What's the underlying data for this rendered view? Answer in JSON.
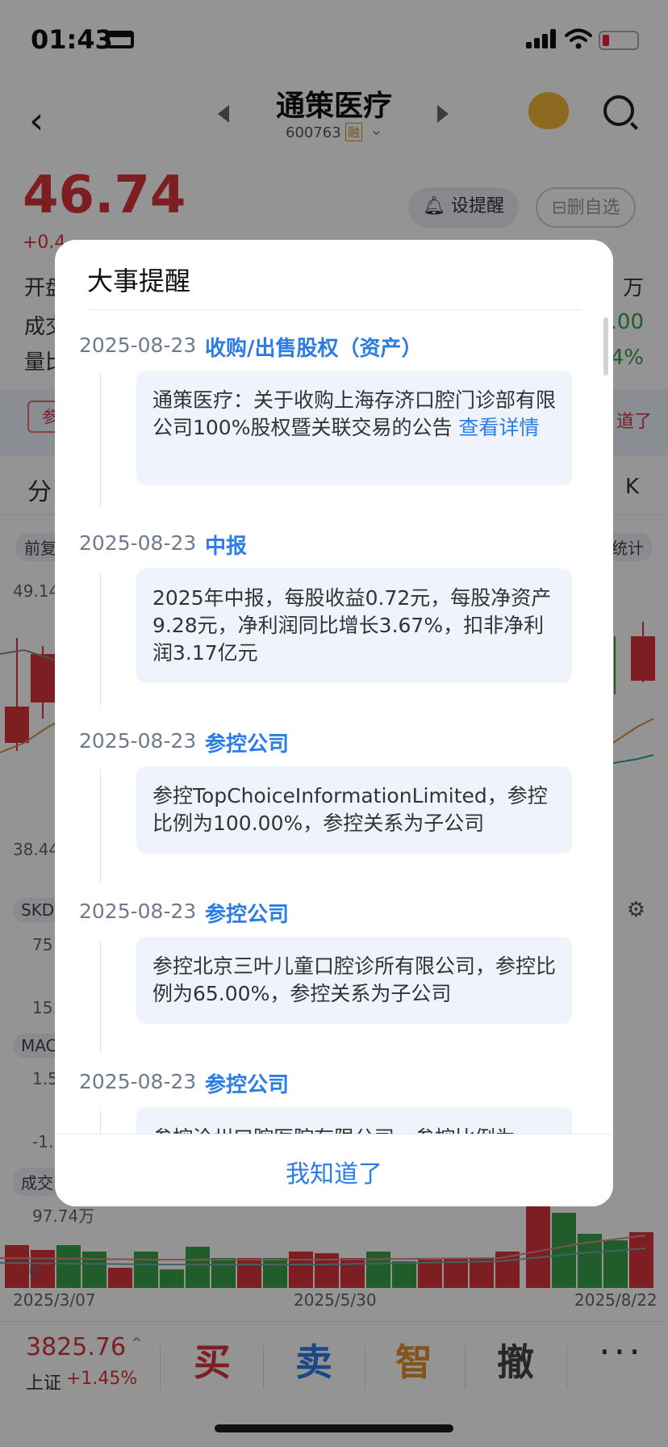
{
  "status_bar": {
    "time": "01:43"
  },
  "header": {
    "stock_name": "通策医疗",
    "stock_code": "600763",
    "margin_tag": "融"
  },
  "quote": {
    "price": "46.74",
    "change_partial": "+0.4",
    "alert_button": "设提醒",
    "remove_watch_button": "删自选",
    "row1_left": "开盘",
    "row1_right": "万",
    "row2_left": "成交",
    "row2_right": ".00",
    "row3_left": "量比",
    "row3_right": "4%"
  },
  "band": {
    "tag_label": "参",
    "know_text": "道了"
  },
  "chart_tabs": {
    "left": "分",
    "right": "K"
  },
  "chart_area": {
    "restore_pill": "前复",
    "stats_pill": "统计",
    "y_top": "49.14",
    "y_bottom": "38.44",
    "skd_label": "SKD",
    "skd_val_top": "75",
    "skd_val_bottom": "15.",
    "macd_label": "MAC",
    "macd_val_top": "1.5",
    "macd_val_bottom": "-1.",
    "vol_label": "成交",
    "vol_max": "97.74万",
    "vol_zero": "0",
    "date_left": "2025/3/07",
    "date_mid": "2025/5/30",
    "date_right": "2025/8/22"
  },
  "bottom_bar": {
    "index_value": "3825.76",
    "index_name": "上证",
    "index_change": "+1.45%",
    "buy": "买",
    "sell": "卖",
    "smart": "智",
    "cancel": "撤",
    "more": "···"
  },
  "colors": {
    "up_red": "#d8343c",
    "down_green": "#3aa04a",
    "accent_blue": "#2b7de4"
  },
  "modal": {
    "title": "大事提醒",
    "ok_button": "我知道了",
    "events": [
      {
        "date": "2025-08-23",
        "type": "收购/出售股权（资产）",
        "text": "通策医疗：关于收购上海存济口腔门诊部有限公司100%股权暨关联交易的公告 ",
        "link": "查看详情"
      },
      {
        "date": "2025-08-23",
        "type": "中报",
        "text": "2025年中报，每股收益0.72元，每股净资产9.28元，净利润同比增长3.67%，扣非净利润3.17亿元"
      },
      {
        "date": "2025-08-23",
        "type": "参控公司",
        "text": "参控TopChoiceInformationLimited，参控比例为100.00%，参控关系为子公司"
      },
      {
        "date": "2025-08-23",
        "type": "参控公司",
        "text": "参控北京三叶儿童口腔诊所有限公司，参控比例为65.00%，参控关系为子公司"
      },
      {
        "date": "2025-08-23",
        "type": "参控公司",
        "text": "参控沧州口腔医院有限公司，参控比例为"
      }
    ]
  }
}
